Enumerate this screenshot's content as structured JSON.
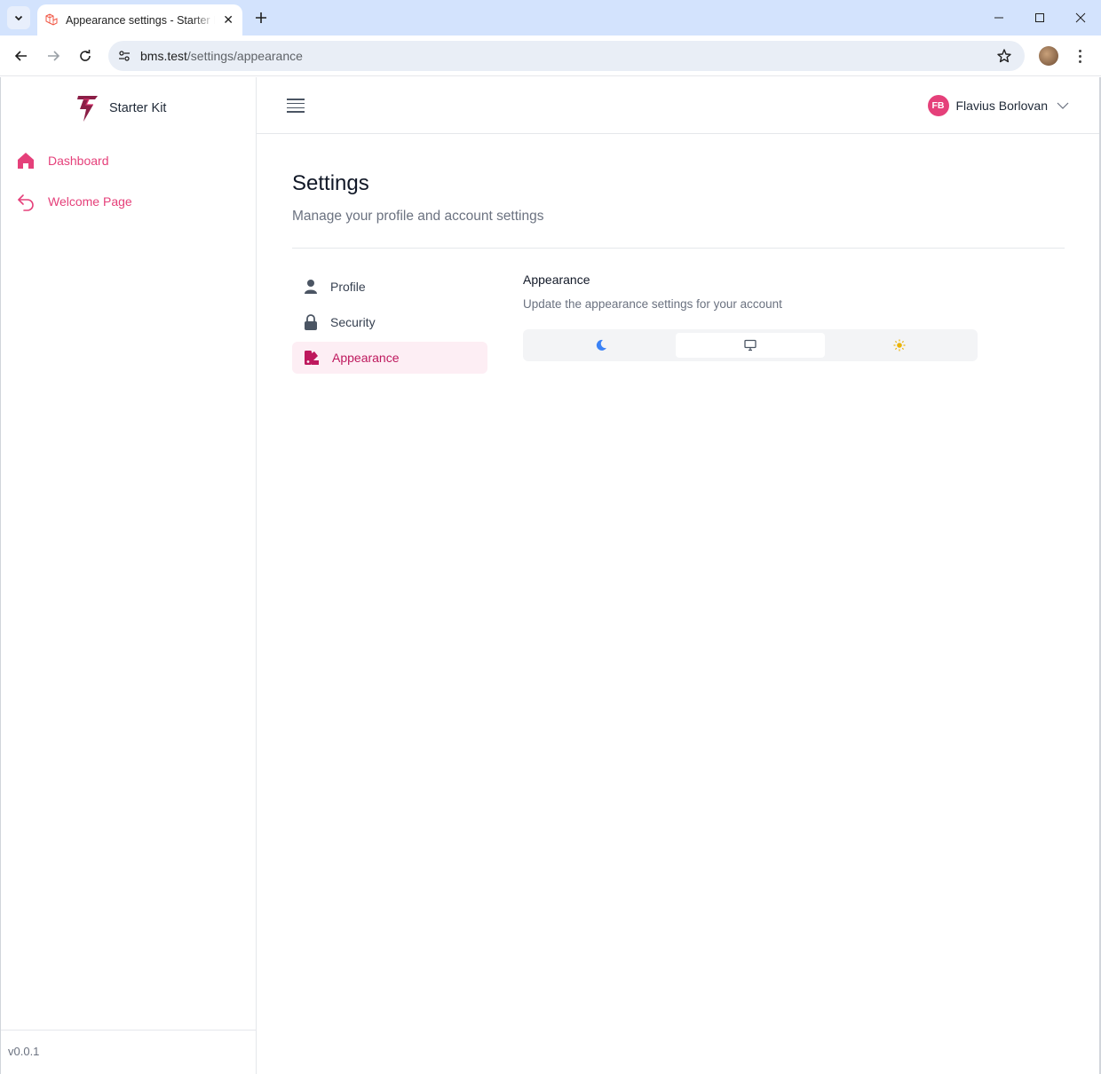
{
  "browser": {
    "tab_title": "Appearance settings - Starter Kit",
    "url_host": "bms.test",
    "url_path": "/settings/appearance"
  },
  "app": {
    "brand": "Starter Kit",
    "version": "v0.0.1"
  },
  "sidebar": {
    "items": [
      {
        "label": "Dashboard",
        "icon": "home-icon"
      },
      {
        "label": "Welcome Page",
        "icon": "undo-arrow-icon"
      }
    ]
  },
  "user": {
    "initials": "FB",
    "name": "Flavius Borlovan"
  },
  "page": {
    "title": "Settings",
    "subtitle": "Manage your profile and account settings"
  },
  "settings_nav": {
    "items": [
      {
        "label": "Profile",
        "icon": "user-icon"
      },
      {
        "label": "Security",
        "icon": "lock-icon"
      },
      {
        "label": "Appearance",
        "icon": "palette-icon",
        "active": true
      }
    ]
  },
  "appearance": {
    "title": "Appearance",
    "description": "Update the appearance settings for your account",
    "options": [
      {
        "icon": "moon-icon",
        "selected": false
      },
      {
        "icon": "monitor-icon",
        "selected": true
      },
      {
        "icon": "sun-icon",
        "selected": false
      }
    ]
  },
  "colors": {
    "accent": "#e5407a",
    "accent_dark": "#be185d",
    "moon": "#3b82f6",
    "sun": "#eab308"
  }
}
